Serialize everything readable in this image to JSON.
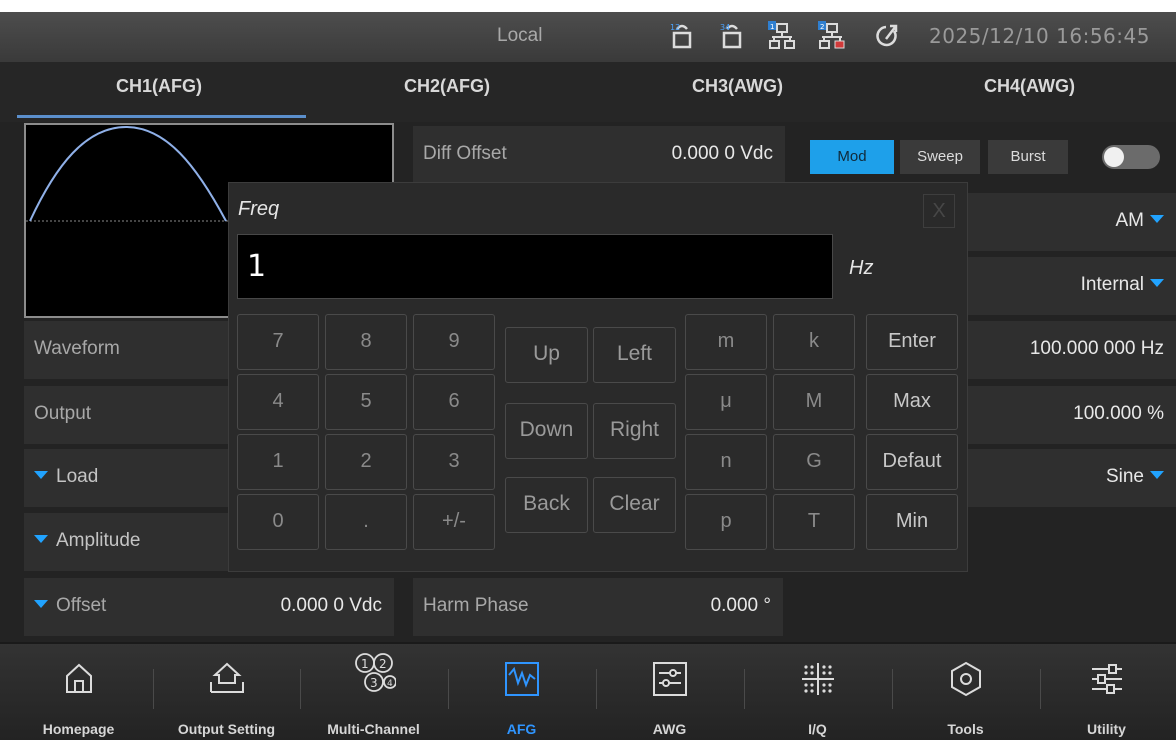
{
  "status": {
    "mode": "Local",
    "datetime": "2025/12/10 16:56:45",
    "icons": [
      "channel-1-2-icon",
      "channel-3-4-icon",
      "network-1-icon",
      "network-2-disconnected-icon",
      "update-icon"
    ],
    "icon_badges": [
      "12",
      "34",
      "1",
      "2"
    ]
  },
  "tabs": [
    "CH1(AFG)",
    "CH2(AFG)",
    "CH3(AWG)",
    "CH4(AWG)"
  ],
  "left_rows": {
    "waveform": "Waveform",
    "output": "Output",
    "load": "Load",
    "amplitude": "Amplitude",
    "offset": {
      "label": "Offset",
      "value": "0.000 0 Vdc"
    }
  },
  "middle_rows": {
    "diff_offset": {
      "label": "Diff Offset",
      "value": "0.000 0 Vdc"
    },
    "harm_phase": {
      "label": "Harm Phase",
      "value": "0.000 °"
    }
  },
  "mode_buttons": [
    "Mod",
    "Sweep",
    "Burst"
  ],
  "right_rows": {
    "mod_type": "AM",
    "source": "Internal",
    "frequency": "100.000 000 Hz",
    "depth": "100.000 %",
    "shape": "Sine"
  },
  "dialog": {
    "title": "Freq",
    "close": "X",
    "input_value": "1",
    "unit": "Hz",
    "digits": [
      "7",
      "8",
      "9",
      "4",
      "5",
      "6",
      "1",
      "2",
      "3",
      "0",
      ".",
      "+/-"
    ],
    "nav": [
      "Up",
      "Left",
      "Down",
      "Right",
      "Back",
      "Clear"
    ],
    "units": [
      "m",
      "k",
      "μ",
      "M",
      "n",
      "G",
      "p",
      "T"
    ],
    "actions": [
      "Enter",
      "Max",
      "Defaut",
      "Min"
    ]
  },
  "bottom": [
    "Homepage",
    "Output Setting",
    "Multi-Channel",
    "AFG",
    "AWG",
    "I/Q",
    "Tools",
    "Utility"
  ],
  "colors": {
    "accent": "#1ea0ea",
    "tab_underline": "#5b8fcc",
    "active_label": "#2f95ff",
    "wave": "#8fb0e8"
  }
}
